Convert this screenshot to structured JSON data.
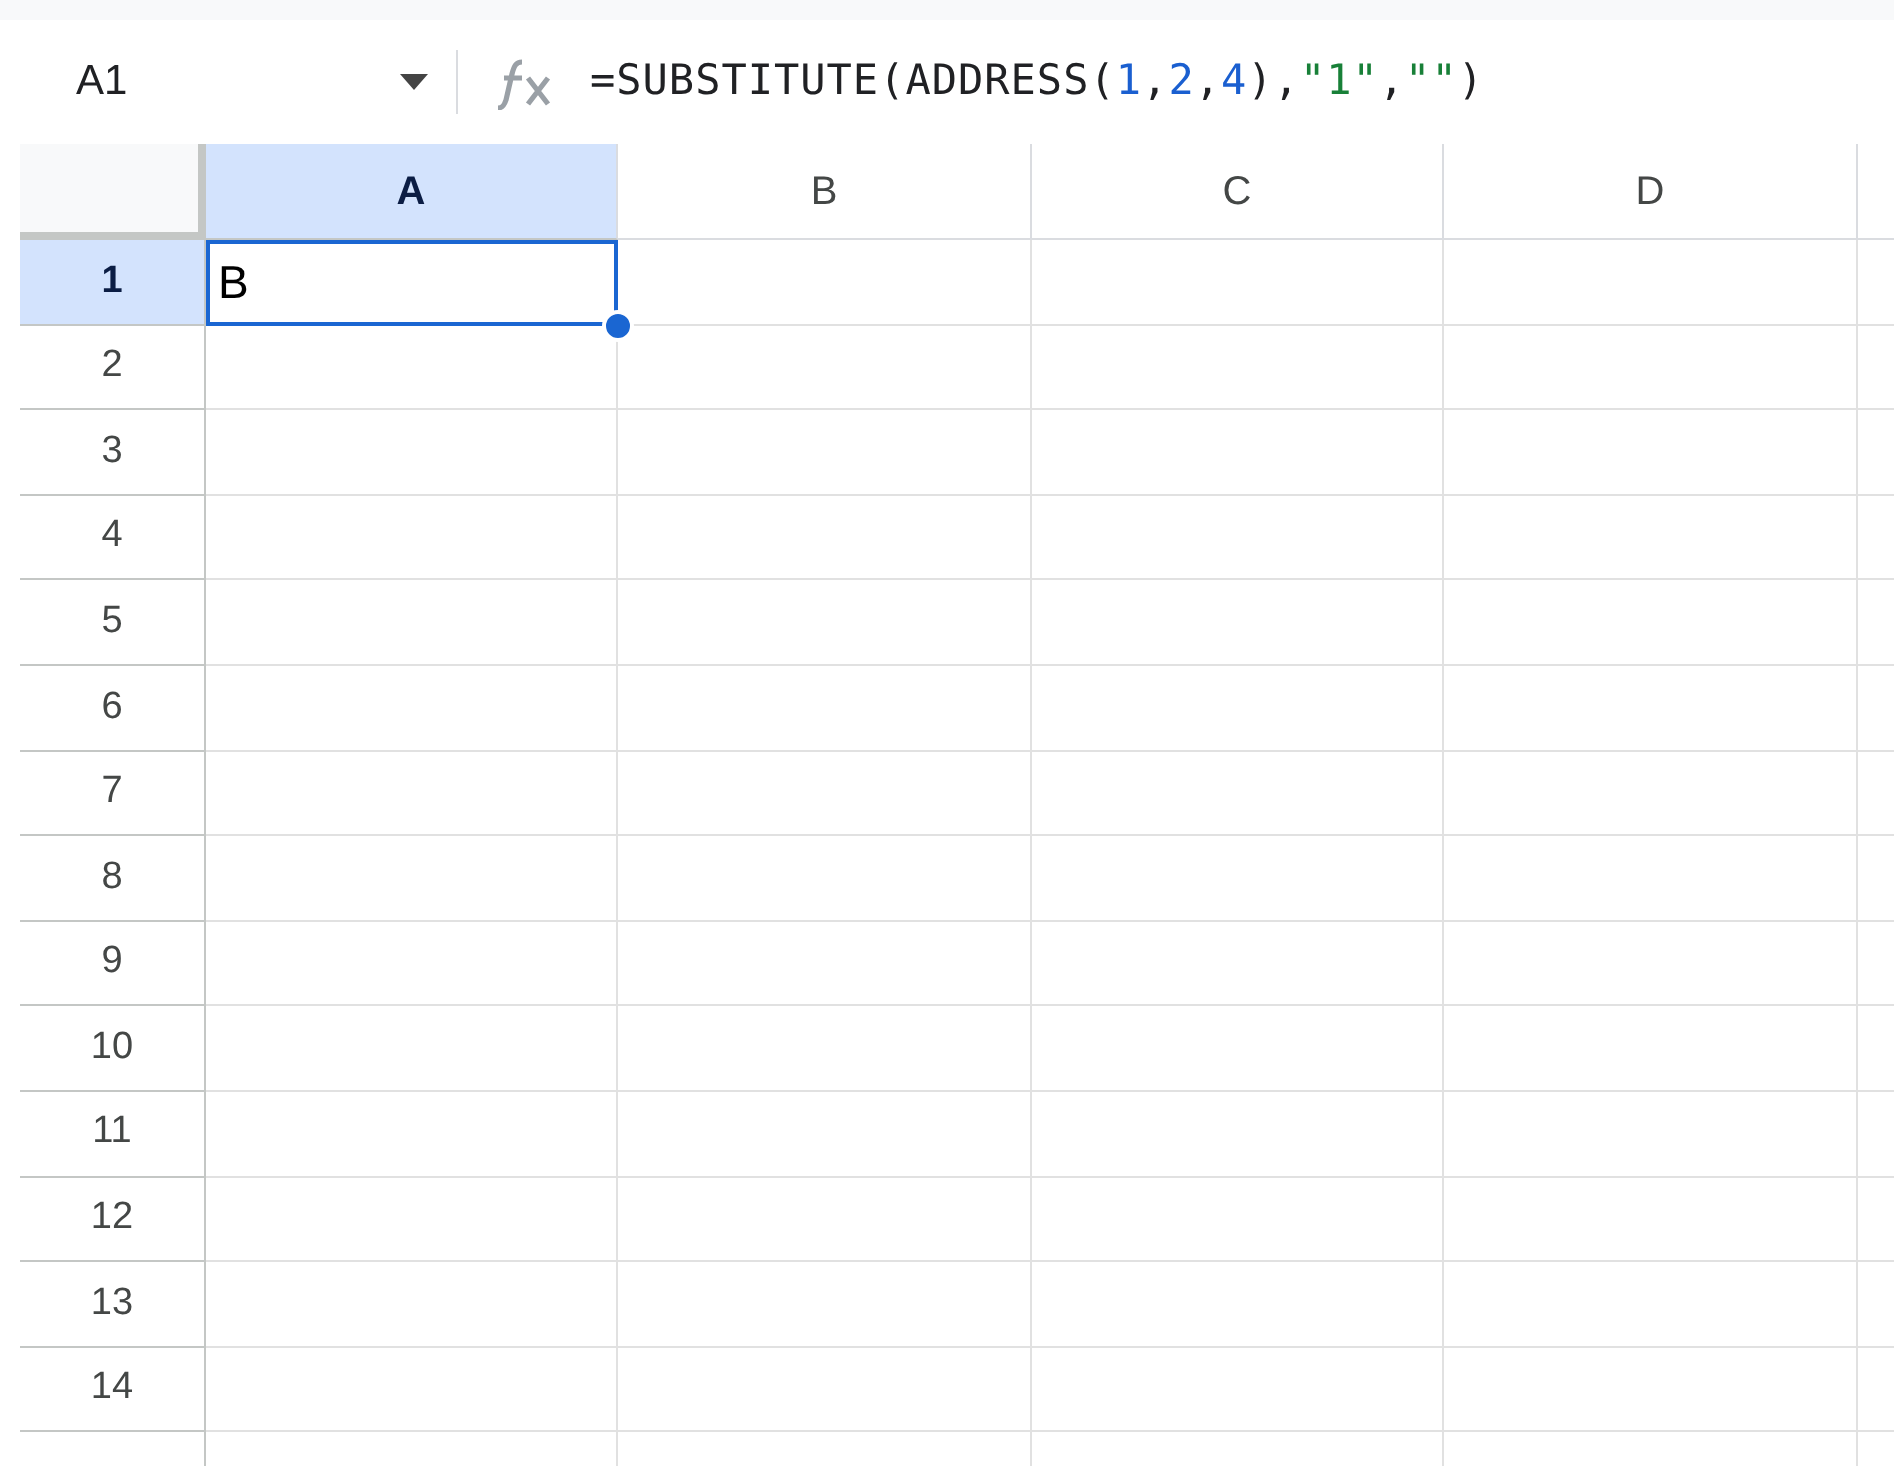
{
  "formula_bar": {
    "name_box": "A1",
    "tokens": [
      {
        "kind": "plain",
        "text": "=SUBSTITUTE(ADDRESS("
      },
      {
        "kind": "number",
        "text": "1"
      },
      {
        "kind": "plain",
        "text": ","
      },
      {
        "kind": "number",
        "text": "2"
      },
      {
        "kind": "plain",
        "text": ","
      },
      {
        "kind": "number",
        "text": "4"
      },
      {
        "kind": "plain",
        "text": "),"
      },
      {
        "kind": "string",
        "text": "\"1\""
      },
      {
        "kind": "plain",
        "text": ","
      },
      {
        "kind": "string",
        "text": "\"\""
      },
      {
        "kind": "plain",
        "text": ")"
      }
    ]
  },
  "grid": {
    "columns": [
      {
        "label": "A",
        "selected": true
      },
      {
        "label": "B",
        "selected": false
      },
      {
        "label": "C",
        "selected": false
      },
      {
        "label": "D",
        "selected": false
      }
    ],
    "rows": [
      {
        "label": "1",
        "selected": true,
        "cells": [
          {
            "text": "B",
            "active": true
          }
        ]
      },
      {
        "label": "2",
        "selected": false
      },
      {
        "label": "3",
        "selected": false
      },
      {
        "label": "4",
        "selected": false
      },
      {
        "label": "5",
        "selected": false
      },
      {
        "label": "6",
        "selected": false
      },
      {
        "label": "7",
        "selected": false
      },
      {
        "label": "8",
        "selected": false
      },
      {
        "label": "9",
        "selected": false
      },
      {
        "label": "10",
        "selected": false
      },
      {
        "label": "11",
        "selected": false
      },
      {
        "label": "12",
        "selected": false
      },
      {
        "label": "13",
        "selected": false
      },
      {
        "label": "14",
        "selected": false
      }
    ]
  }
}
